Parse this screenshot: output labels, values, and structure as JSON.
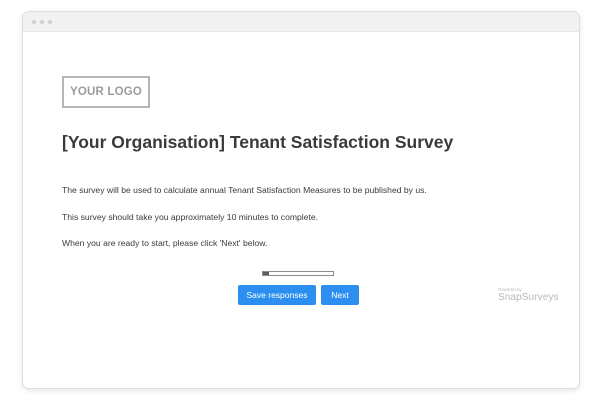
{
  "logo": {
    "text": "YOUR LOGO"
  },
  "survey": {
    "title": "[Your Organisation] Tenant Satisfaction Survey",
    "paragraphs": [
      "The survey will be used to calculate annual Tenant Satisfaction Measures to be published by us.",
      "This survey should take you approximately 10 minutes to complete.",
      "When you are ready to start, please click 'Next' below."
    ],
    "progress_fraction": 0.08
  },
  "buttons": {
    "save_label": "Save responses",
    "next_label": "Next"
  },
  "powered_by": {
    "label": "Powered by",
    "brand": "SnapSurveys"
  },
  "colors": {
    "button": "#2c8ff0",
    "title_text": "#3a3a3a",
    "logo_border": "#b6b6b6"
  }
}
